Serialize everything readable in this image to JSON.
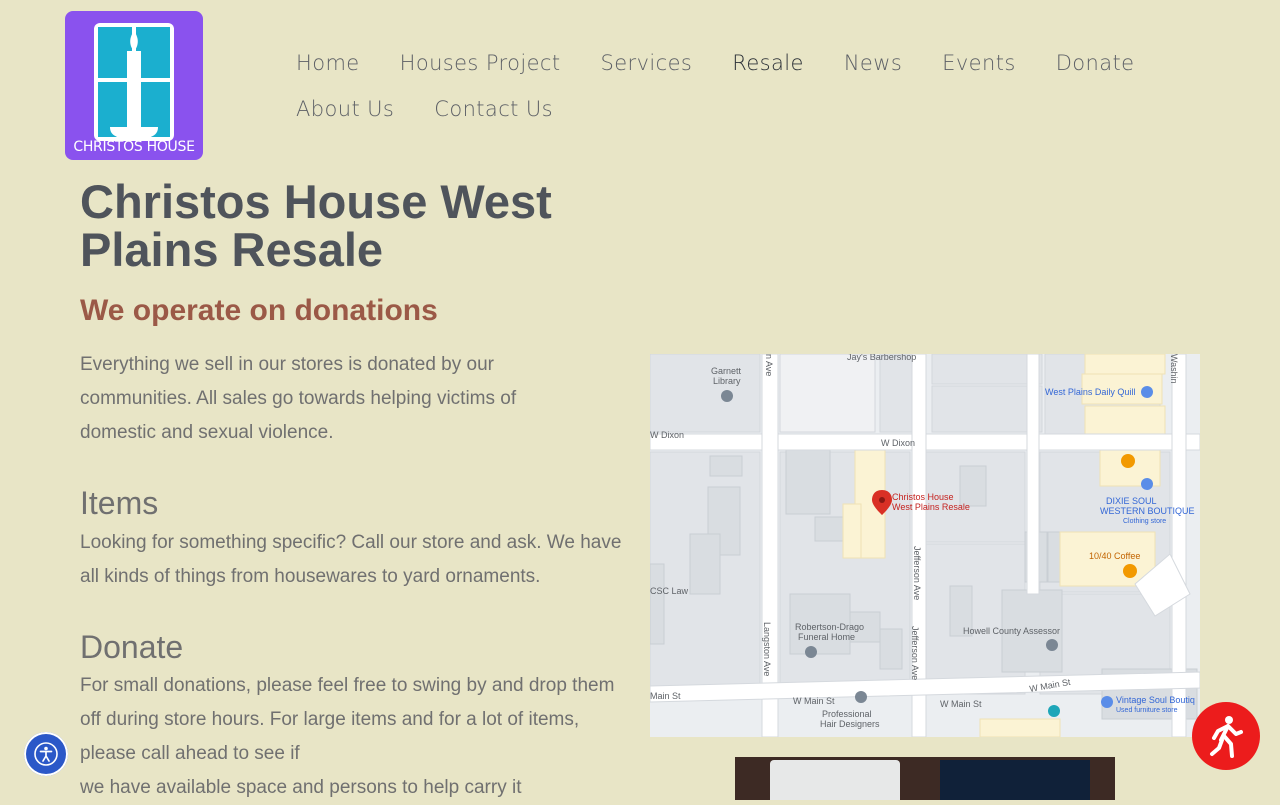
{
  "brand": {
    "logo_text": "CHRISTOS HOUSE",
    "logo_bg": "#8a52ee",
    "logo_window_color": "#1bafcf"
  },
  "nav": {
    "items": [
      {
        "label": "Home"
      },
      {
        "label": "Houses Project"
      },
      {
        "label": "Services"
      },
      {
        "label": "Resale",
        "active": true
      },
      {
        "label": "News"
      },
      {
        "label": "Events"
      },
      {
        "label": "Donate"
      },
      {
        "label": "About Us"
      },
      {
        "label": "Contact Us"
      }
    ]
  },
  "page": {
    "title": "Christos House West Plains Resale",
    "tagline": "We operate on donations",
    "intro": "Everything we sell in our stores is donated by our communities. All sales go towards helping victims of domestic and sexual violence.",
    "items_heading": "Items",
    "items_text": "Looking for something specific? Call our store and ask. We have all kinds of things from housewares to yard ornaments.",
    "donate_heading": "Donate",
    "donate_text_1": "For small donations, please feel free to swing by and drop them off during store hours. For large items and for a lot of items, please call ahead to see if",
    "donate_text_2": "we have available space and persons to help carry it"
  },
  "map": {
    "labels": {
      "barbershop": "Jay's Barbershop",
      "library_1": "Garnett",
      "library_2": "Library",
      "ave_top": "n Ave",
      "washington": "Washin",
      "daily_quill": "West Plains Daily Quill",
      "w_dixon_left": "W Dixon",
      "w_dixon": "W Dixon",
      "pin_1": "Christos House",
      "pin_2": "West Plains Resale",
      "dixie_1": "DIXIE SOUL",
      "dixie_2": "WESTERN BOUTIQUE",
      "dixie_3": "Clothing store",
      "coffee": "10/40 Coffee",
      "csc_law": "CSC Law",
      "jefferson_1": "Jefferson Ave",
      "jefferson_2": "Jefferson Ave",
      "langston": "Langston Ave",
      "funeral_1": "Robertson-Drago",
      "funeral_2": "Funeral Home",
      "assessor": "Howell County Assessor",
      "main_st_left": "Main St",
      "w_main_1": "W Main St",
      "w_main_2": "W Main St",
      "w_main_3": "W Main St",
      "hair_1": "Professional",
      "hair_2": "Hair Designers",
      "vintage_1": "Vintage Soul Boutiq",
      "vintage_2": "Used furniture store"
    },
    "pin_color": "#d93025",
    "pin_label_color": "#c5221f"
  },
  "widgets": {
    "accessibility_icon": "accessibility-icon",
    "help_icon": "walking-person-icon",
    "help_color": "#ec1c1c",
    "accessibility_color": "#2b58c8"
  }
}
